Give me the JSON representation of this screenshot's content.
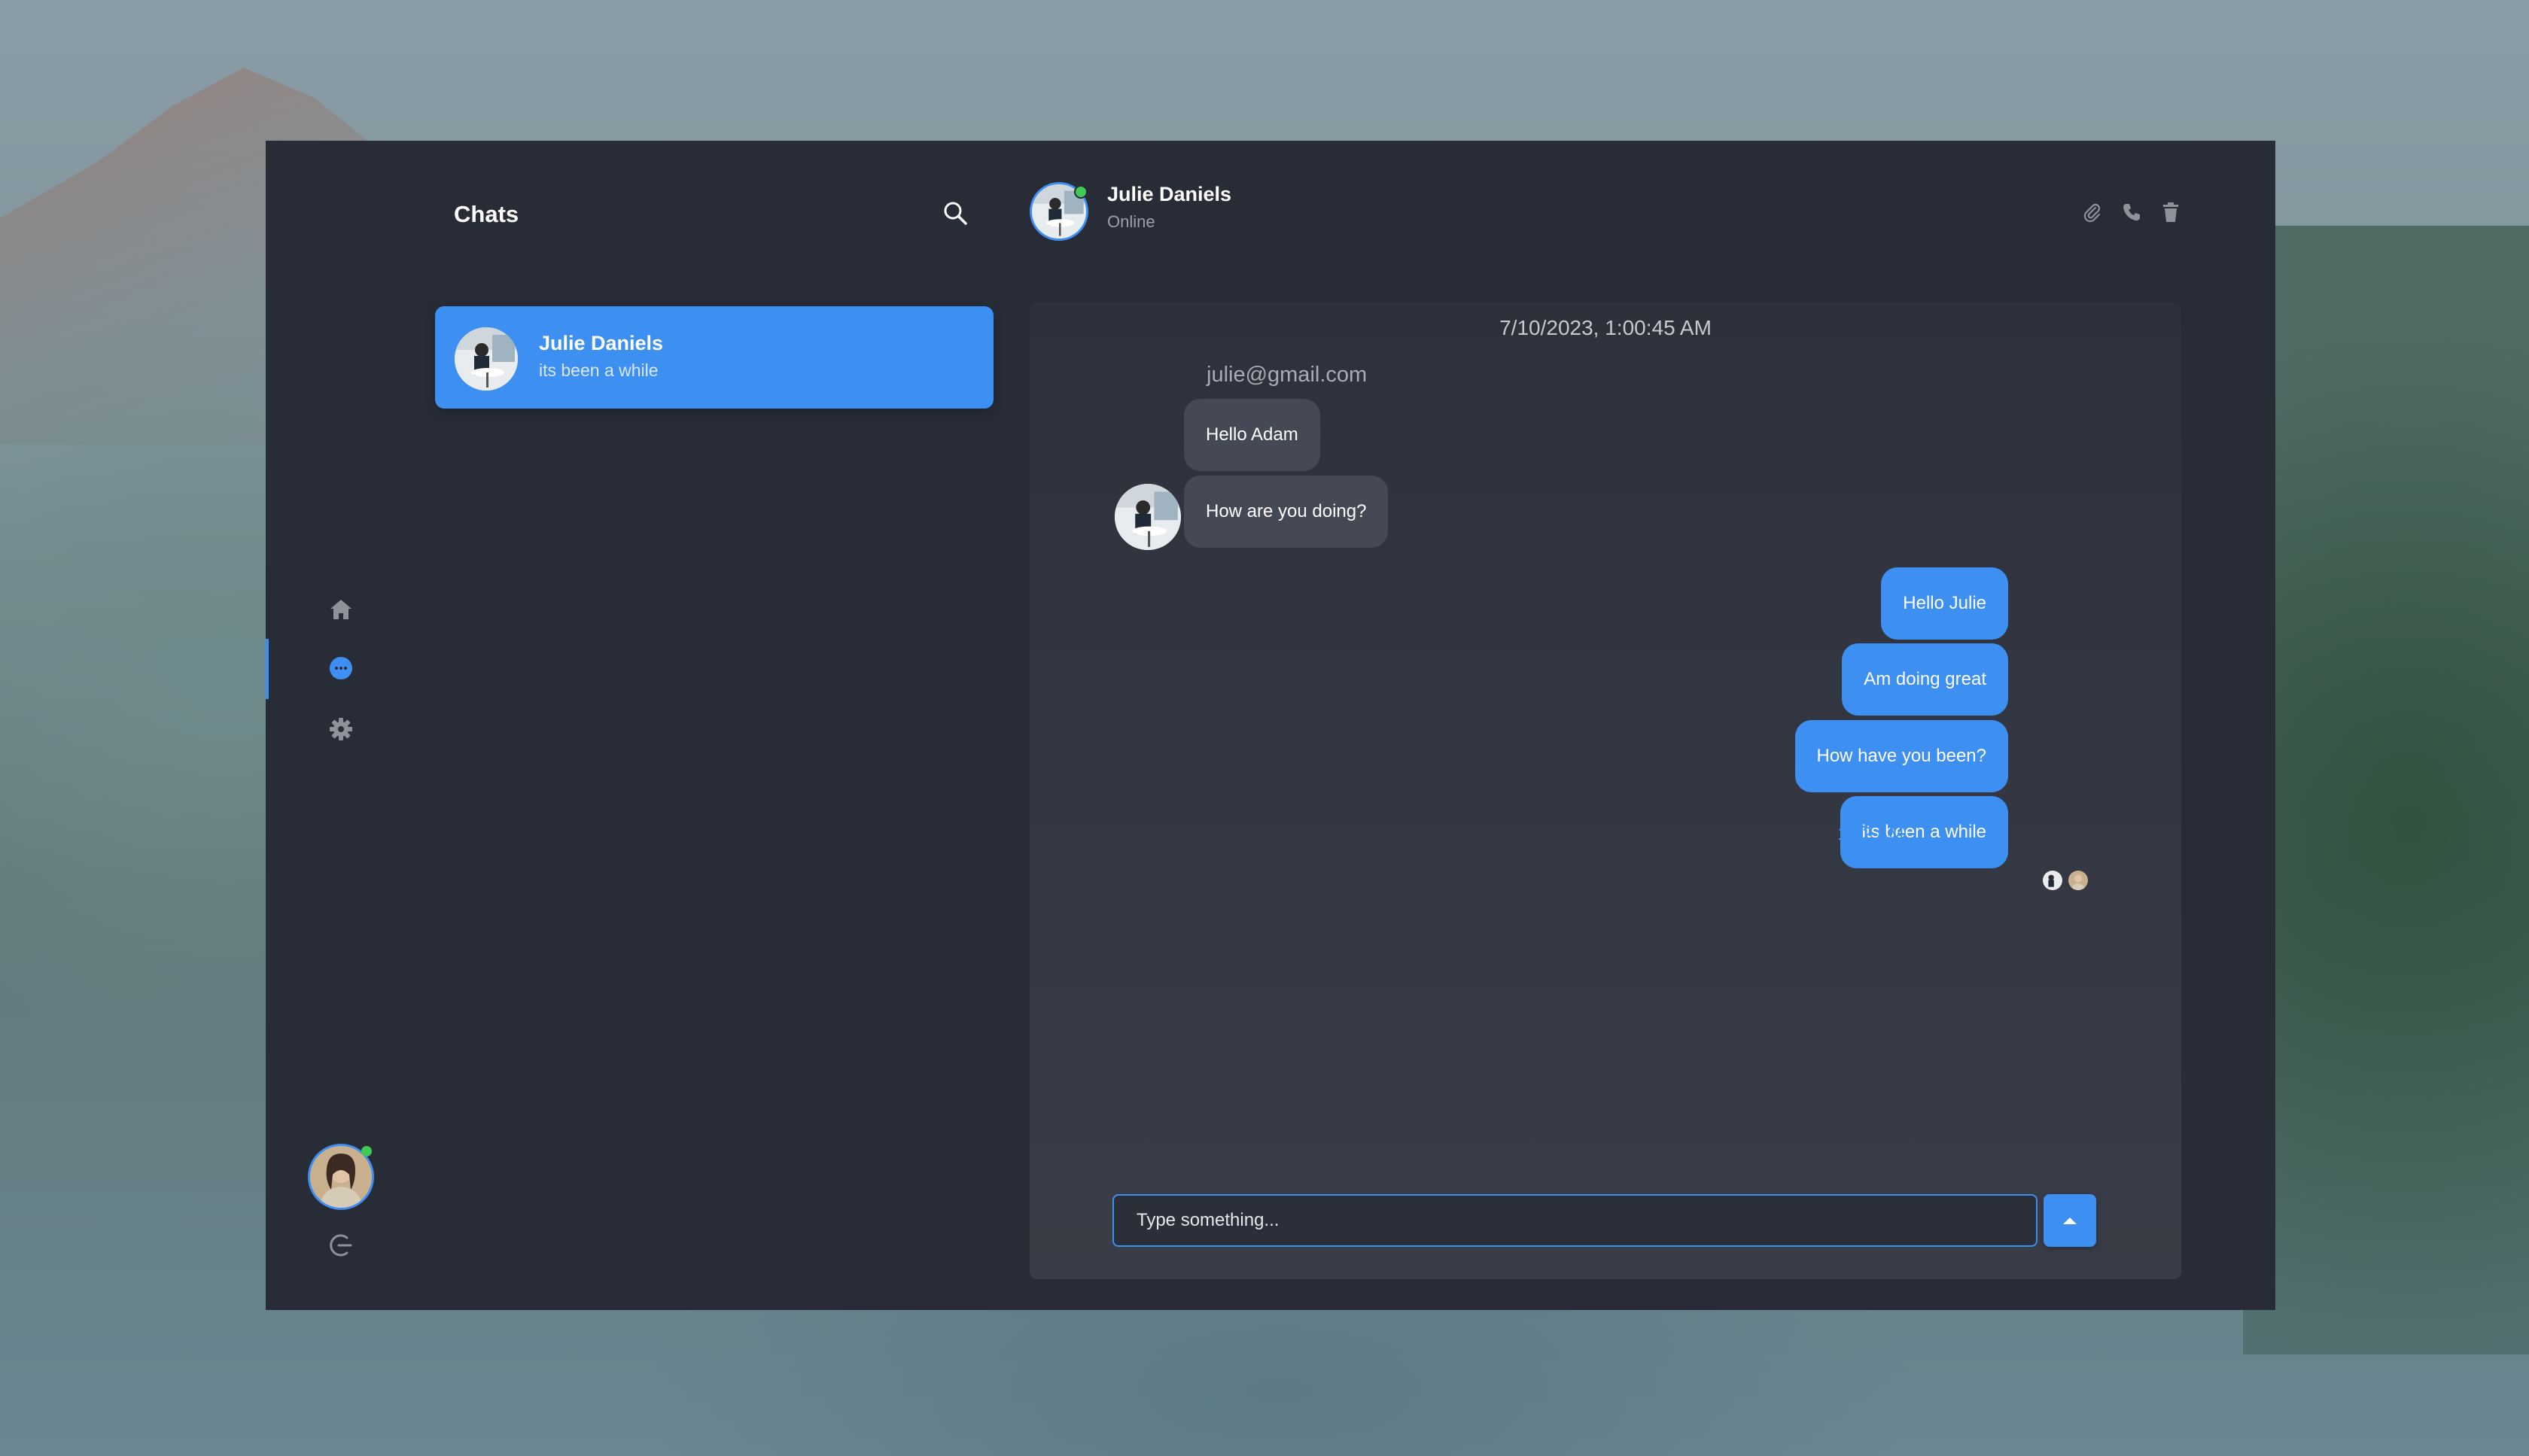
{
  "sidebar": {
    "title": "Chats",
    "nav": [
      "home-icon",
      "chat-icon",
      "gear-icon"
    ],
    "active_nav": "chat-icon"
  },
  "conversations": [
    {
      "name": "Julie Daniels",
      "preview": "its been a while",
      "selected": true
    }
  ],
  "chat_header": {
    "name": "Julie Daniels",
    "status": "Online",
    "actions": [
      "attach-icon",
      "phone-icon",
      "trash-icon"
    ]
  },
  "messages": {
    "timestamp": "7/10/2023, 1:00:45 AM",
    "sender_email": "julie@gmail.com",
    "incoming": [
      {
        "text": "Hello Adam"
      },
      {
        "text": "How are you doing?"
      }
    ],
    "outgoing": [
      {
        "text": "Hello Julie"
      },
      {
        "text": "Am doing great"
      },
      {
        "text": "How have you been?"
      },
      {
        "text": "its been a while"
      }
    ],
    "last_time": "1:02 AM"
  },
  "composer": {
    "placeholder": "Type something..."
  },
  "colors": {
    "accent": "#3d8ff2",
    "app_bg": "#282c37",
    "online": "#3fca55"
  }
}
